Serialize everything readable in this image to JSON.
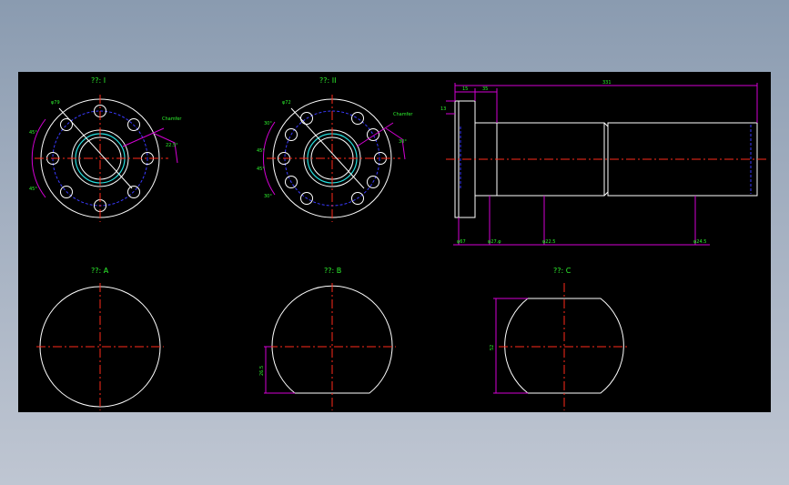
{
  "drawing": {
    "background": "#000000",
    "colors": {
      "outline": "#ffffff",
      "centerline": "#ff2a1a",
      "dimension": "#d400d4",
      "hidden": "#3a3aff",
      "text": "#2ef22e"
    }
  },
  "views": {
    "flange_1": {
      "title": "??: I",
      "dims": {
        "d": "φ79",
        "angle_a": "45°",
        "angle_b": "45°",
        "chamfer": "Chamfer",
        "angle_c": "22.5°"
      }
    },
    "flange_2": {
      "title": "??: II",
      "dims": {
        "d": "φ72",
        "a1": "30°",
        "a2": "45°",
        "a3": "45°",
        "a4": "30°",
        "chamfer": "Chamfer",
        "angle_c": "30°"
      }
    },
    "shaft": {
      "dims": {
        "total": "331",
        "l1": "15",
        "l2": "35",
        "h": "13",
        "d1": "φ67",
        "d2": "φ27.φ",
        "d3": "φ22.5",
        "d4": "φ24.5"
      }
    },
    "section_a": {
      "title": "??: A"
    },
    "section_b": {
      "title": "??: B",
      "dims": {
        "flat": "26.5"
      }
    },
    "section_c": {
      "title": "??: C",
      "dims": {
        "width": "52"
      }
    }
  }
}
